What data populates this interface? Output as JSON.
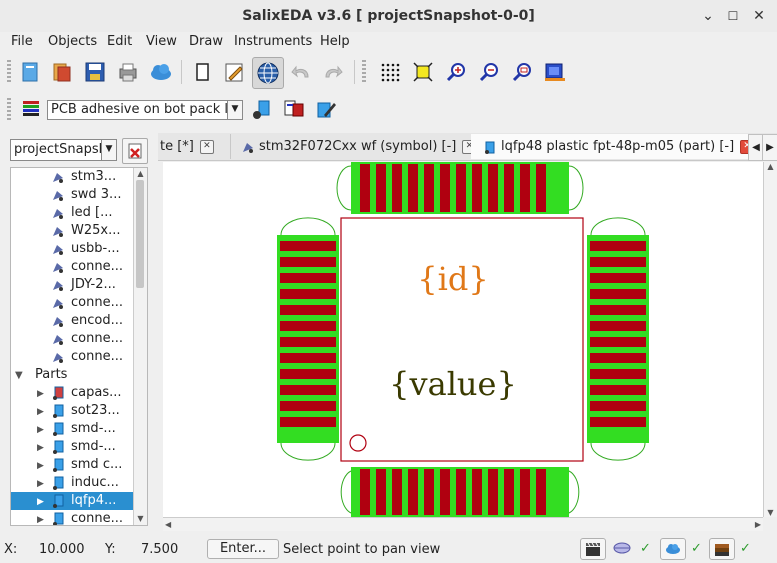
{
  "window": {
    "title": "SalixEDA v3.6 [ projectSnapshot-0-0]",
    "minimize": "⌄",
    "maximize": "☐",
    "close": "✕"
  },
  "menu": [
    "File",
    "Objects",
    "Edit",
    "View",
    "Draw",
    "Instruments",
    "Help"
  ],
  "toolbar2": {
    "layer_select": "PCB adhesive on bot pack last"
  },
  "project": {
    "select_value": "projectSnapsh"
  },
  "tree": {
    "items": [
      "stm3...",
      "swd 3...",
      "led [...",
      "W25x...",
      "usbb-...",
      "conne...",
      "JDY-2...",
      "conne...",
      "encod...",
      "conne...",
      "conne..."
    ],
    "parts_label": "Parts",
    "parts": [
      "capas...",
      "sot23...",
      "smd-...",
      "smd-...",
      "smd c...",
      "induc...",
      "lqfp4...",
      "conne..."
    ],
    "selected_index": 6
  },
  "tabs": [
    {
      "label": "te [*]",
      "close": "✕"
    },
    {
      "label": "stm32F072Cxx wf (symbol) [-]",
      "close": "✕"
    },
    {
      "label": "lqfp48 plastic fpt-48p-m05 (part) [-]",
      "close": "✕"
    }
  ],
  "canvas": {
    "id_text": "{id}",
    "value_text": "{value}",
    "colors": {
      "pad": "#b00010",
      "pad_border": "#33dd22",
      "outline": "#b00010",
      "id": "#e07818",
      "value": "#3a3a00"
    }
  },
  "status": {
    "x_label": "X:",
    "x_value": "10.000",
    "y_label": "Y:",
    "y_value": "7.500",
    "enter_button": "Enter...",
    "message": "Select point to pan view",
    "checks": [
      "✓",
      "✓",
      "✓"
    ]
  }
}
